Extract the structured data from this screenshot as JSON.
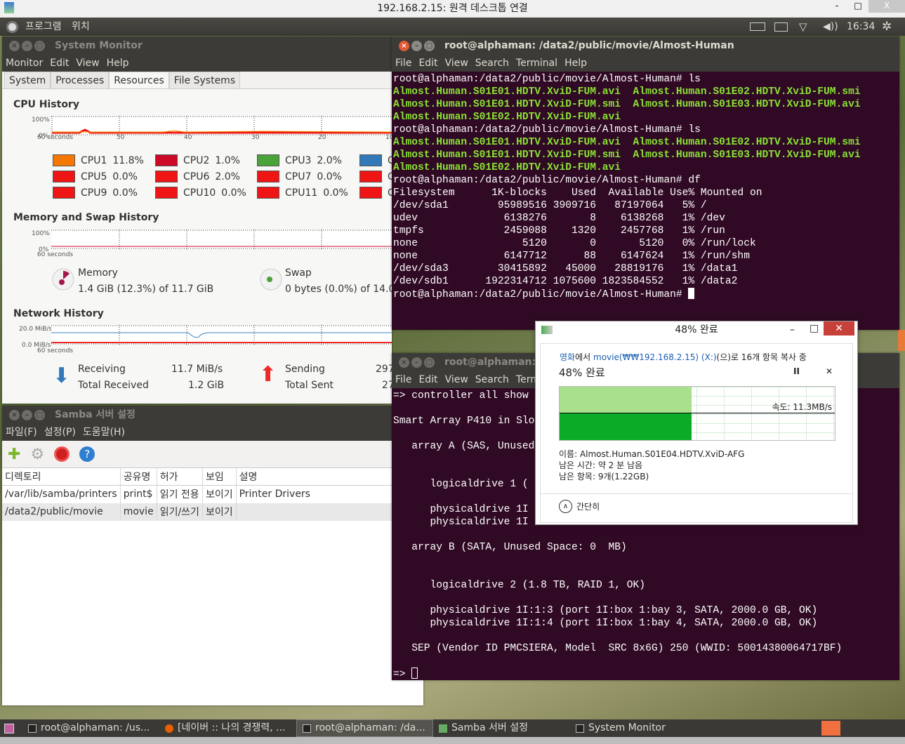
{
  "rdp": {
    "title": "192.168.2.15: 원격 데스크톱 연결",
    "min": "-",
    "max": "□",
    "close": "X"
  },
  "panel": {
    "apps": "프로그램",
    "places": "위치",
    "clock": "16:34"
  },
  "sysmon": {
    "title": "System Monitor",
    "menu": [
      "Monitor",
      "Edit",
      "View",
      "Help"
    ],
    "tabs": [
      "System",
      "Processes",
      "Resources",
      "File Systems"
    ],
    "selected_tab": "Resources",
    "cpu": {
      "title": "CPU History",
      "y_top": "100%",
      "y_bottom": "0%",
      "x_labels": [
        "60 seconds",
        "50",
        "40",
        "30",
        "20",
        "10"
      ],
      "legend": [
        {
          "label": "CPU1",
          "value": "11.8%",
          "color": "#f57900"
        },
        {
          "label": "CPU2",
          "value": "1.0%",
          "color": "#cc0a27"
        },
        {
          "label": "CPU3",
          "value": "2.0%",
          "color": "#4aa33a"
        },
        {
          "label": "C",
          "value": "",
          "color": "#3179b8"
        },
        {
          "label": "CPU5",
          "value": "0.0%",
          "color": "#ef1515"
        },
        {
          "label": "CPU6",
          "value": "2.0%",
          "color": "#ef1515"
        },
        {
          "label": "CPU7",
          "value": "0.0%",
          "color": "#ef1515"
        },
        {
          "label": "C",
          "value": "",
          "color": "#ef1515"
        },
        {
          "label": "CPU9",
          "value": "0.0%",
          "color": "#ef1515"
        },
        {
          "label": "CPU10",
          "value": "0.0%",
          "color": "#ef1515"
        },
        {
          "label": "CPU11",
          "value": "0.0%",
          "color": "#ef1515"
        },
        {
          "label": "C",
          "value": "",
          "color": "#ef1515"
        }
      ]
    },
    "mem": {
      "title": "Memory and Swap History",
      "y_top": "100%",
      "y_bottom": "0%",
      "memory_label": "Memory",
      "memory_value": "1.4 GiB (12.3%) of 11.7 GiB",
      "swap_label": "Swap",
      "swap_value": "0 bytes (0.0%) of 14.0 G"
    },
    "net": {
      "title": "Network History",
      "y_top": "20.0 MiB/s",
      "y_bottom": "0.0 MiB/s",
      "receiving_label": "Receiving",
      "receiving_value": "11.7 MiB/s",
      "total_received_label": "Total Received",
      "total_received_value": "1.2 GiB",
      "sending_label": "Sending",
      "sending_value": "297",
      "total_sent_label": "Total Sent",
      "total_sent_value": "27"
    }
  },
  "samba": {
    "title": "Samba 서버 설정",
    "menu": [
      "파일(F)",
      "설정(P)",
      "도움말(H)"
    ],
    "columns": [
      "디렉토리",
      "공유명",
      "허가",
      "보임",
      "설명"
    ],
    "rows": [
      [
        "/var/lib/samba/printers",
        "print$",
        "읽기 전용",
        "보이기",
        "Printer Drivers"
      ],
      [
        "/data2/public/movie",
        "movie",
        "읽기/쓰기",
        "보이기",
        ""
      ]
    ]
  },
  "term1": {
    "title": "root@alphaman: /data2/public/movie/Almost-Human",
    "menu": [
      "File",
      "Edit",
      "View",
      "Search",
      "Terminal",
      "Help"
    ],
    "lines": [
      {
        "t": "root@alphaman:/data2/public/movie/Almost-Human# ls",
        "g": false
      },
      {
        "t": "Almost.Human.S01E01.HDTV.XviD-FUM.avi  Almost.Human.S01E02.HDTV.XviD-FUM.smi",
        "g": true
      },
      {
        "t": "Almost.Human.S01E01.HDTV.XviD-FUM.smi  Almost.Human.S01E03.HDTV.XviD-FUM.avi",
        "g": true
      },
      {
        "t": "Almost.Human.S01E02.HDTV.XviD-FUM.avi",
        "g": true
      },
      {
        "t": "root@alphaman:/data2/public/movie/Almost-Human# ls",
        "g": false
      },
      {
        "t": "Almost.Human.S01E01.HDTV.XviD-FUM.avi  Almost.Human.S01E02.HDTV.XviD-FUM.smi",
        "g": true
      },
      {
        "t": "Almost.Human.S01E01.HDTV.XviD-FUM.smi  Almost.Human.S01E03.HDTV.XviD-FUM.avi",
        "g": true
      },
      {
        "t": "Almost.Human.S01E02.HDTV.XviD-FUM.avi",
        "g": true
      },
      {
        "t": "root@alphaman:/data2/public/movie/Almost-Human# df",
        "g": false
      },
      {
        "t": "Filesystem      1K-blocks    Used  Available Use% Mounted on",
        "g": false
      },
      {
        "t": "/dev/sda1        95989516 3909716   87197064   5% /",
        "g": false
      },
      {
        "t": "udev              6138276       8    6138268   1% /dev",
        "g": false
      },
      {
        "t": "tmpfs             2459088    1320    2457768   1% /run",
        "g": false
      },
      {
        "t": "none                 5120       0       5120   0% /run/lock",
        "g": false
      },
      {
        "t": "none              6147712      88    6147624   1% /run/shm",
        "g": false
      },
      {
        "t": "/dev/sda3        30415892   45000   28819176   1% /data1",
        "g": false
      },
      {
        "t": "/dev/sdb1      1922314712 1075600 1823584552   1% /data2",
        "g": false
      }
    ],
    "prompt": "root@alphaman:/data2/public/movie/Almost-Human# "
  },
  "term2": {
    "title": "root@alphaman: /",
    "menu": [
      "File",
      "Edit",
      "View",
      "Search",
      "Term"
    ],
    "lines": [
      "=> controller all show",
      "",
      "Smart Array P410 in Slo",
      "",
      "   array A (SAS, Unused",
      "",
      "",
      "      logicaldrive 1 (",
      "",
      "      physicaldrive 1I",
      "      physicaldrive 1I",
      "",
      "   array B (SATA, Unused Space: 0  MB)",
      "",
      "",
      "      logicaldrive 2 (1.8 TB, RAID 1, OK)",
      "",
      "      physicaldrive 1I:1:3 (port 1I:box 1:bay 3, SATA, 2000.0 GB, OK)",
      "      physicaldrive 1I:1:4 (port 1I:box 1:bay 4, SATA, 2000.0 GB, OK)",
      "",
      "   SEP (Vendor ID PMCSIERA, Model  SRC 8x6G) 250 (WWID: 50014380064717BF)",
      ""
    ],
    "prompt": "=> "
  },
  "copy": {
    "title": "48% 완료",
    "src": "영화",
    "src_suffix": "에서 ",
    "dest": "movie(₩₩192.168.2.15) (X:)",
    "dest_suffix": "(으)로 16개 항목 복사 중",
    "heading": "48% 완료",
    "progress_percent": 48,
    "speed": "속도: 11.3MB/s",
    "name": "이름: Almost.Human.S01E04.HDTV.XviD-AFG",
    "time_left": "남은 시간: 약 2 분 남음",
    "items_left": "남은 항목: 9개(1.22GB)",
    "less": "간단히",
    "pause": "II",
    "cancel": "✕"
  },
  "taskbar": [
    {
      "label": "root@alphaman: /us...",
      "icon": "terminal-icon"
    },
    {
      "label": "[네이버 :: 나의 경쟁력, ...",
      "icon": "firefox-icon"
    },
    {
      "label": "root@alphaman: /da...",
      "icon": "terminal-icon",
      "active": true
    },
    {
      "label": "Samba 서버 설정",
      "icon": "samba-icon"
    },
    {
      "label": "System Monitor",
      "icon": "system-monitor-icon"
    }
  ]
}
